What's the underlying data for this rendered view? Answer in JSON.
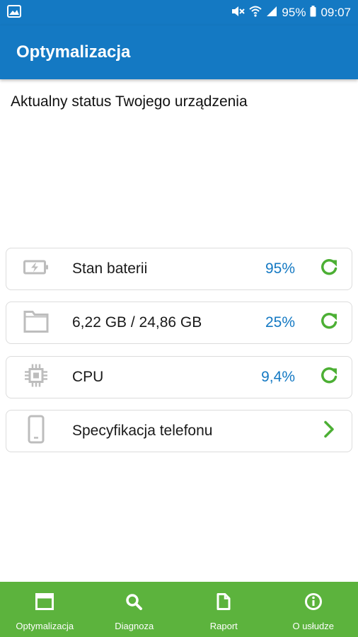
{
  "status_bar": {
    "battery_percent": "95%",
    "time": "09:07"
  },
  "app_bar": {
    "title": "Optymalizacja"
  },
  "main": {
    "heading": "Aktualny status Twojego urządzenia",
    "cards": [
      {
        "icon": "battery-icon",
        "label": "Stan baterii",
        "value": "95%",
        "action_icon": "refresh-icon"
      },
      {
        "icon": "folder-icon",
        "label": "6,22 GB / 24,86 GB",
        "value": "25%",
        "action_icon": "refresh-icon"
      },
      {
        "icon": "cpu-chip-icon",
        "label": "CPU",
        "value": "9,4%",
        "action_icon": "refresh-icon"
      },
      {
        "icon": "phone-icon",
        "label": "Specyfikacja telefonu",
        "value": "",
        "action_icon": "chevron-right-icon"
      }
    ]
  },
  "bottom_nav": {
    "items": [
      {
        "label": "Optymalizacja",
        "icon": "window-icon"
      },
      {
        "label": "Diagnoza",
        "icon": "search-icon"
      },
      {
        "label": "Raport",
        "icon": "document-icon"
      },
      {
        "label": "O usłudze",
        "icon": "info-icon"
      }
    ]
  },
  "colors": {
    "primary_blue": "#1479c3",
    "accent_green": "#5cb33d",
    "refresh_green": "#4caf34",
    "icon_gray": "#bdbdbd"
  }
}
